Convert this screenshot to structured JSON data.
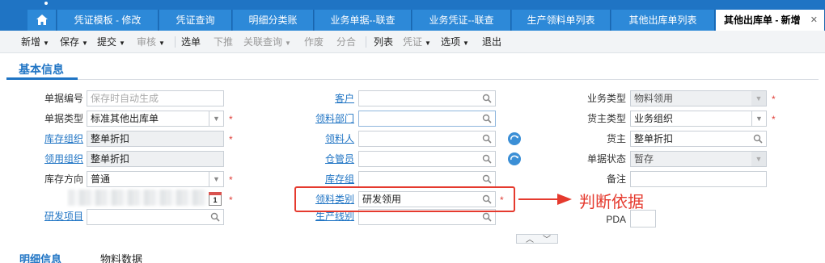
{
  "tabs": [
    {
      "label": "凭证模板 - 修改"
    },
    {
      "label": "凭证查询"
    },
    {
      "label": "明细分类账"
    },
    {
      "label": "业务单据--联查"
    },
    {
      "label": "业务凭证--联查"
    },
    {
      "label": "生产领料单列表"
    },
    {
      "label": "其他出库单列表"
    },
    {
      "label": "其他出库单 - 新增"
    }
  ],
  "toolbar": {
    "new": "新增",
    "save": "保存",
    "submit": "提交",
    "audit": "审核",
    "select": "选单",
    "push": "下推",
    "link_query": "关联查询",
    "void": "作废",
    "merge": "分合",
    "list": "列表",
    "voucher": "凭证",
    "options": "选项",
    "exit": "退出"
  },
  "section": {
    "title": "基本信息"
  },
  "form": {
    "doc_no": {
      "label": "单据编号",
      "placeholder": "保存时自动生成"
    },
    "doc_type": {
      "label": "单据类型",
      "value": "标准其他出库单"
    },
    "stock_org": {
      "label": "库存组织",
      "value": "整单折扣"
    },
    "use_org": {
      "label": "领用组织",
      "value": "整单折扣"
    },
    "stock_dir": {
      "label": "库存方向",
      "value": "普通"
    },
    "date": {
      "cal_day": "1"
    },
    "rd_project": {
      "label": "研发项目",
      "value": ""
    },
    "customer": {
      "label": "客户",
      "value": ""
    },
    "dept": {
      "label": "领料部门",
      "value": ""
    },
    "picker": {
      "label": "领料人",
      "value": ""
    },
    "keeper": {
      "label": "仓管员",
      "value": ""
    },
    "stock_group": {
      "label": "库存组",
      "value": ""
    },
    "pick_type": {
      "label": "领料类别",
      "value": "研发领用"
    },
    "prod_line": {
      "label": "生产线别",
      "value": ""
    },
    "biz_type": {
      "label": "业务类型",
      "value": "物料领用"
    },
    "owner_type": {
      "label": "货主类型",
      "value": "业务组织"
    },
    "owner": {
      "label": "货主",
      "value": "整单折扣"
    },
    "doc_status": {
      "label": "单据状态",
      "value": "暂存"
    },
    "remark": {
      "label": "备注",
      "value": ""
    },
    "pda": {
      "label": "PDA",
      "value": ""
    }
  },
  "required_mark": "*",
  "annotation": {
    "text": "判断依据",
    "color": "#e53a2e"
  },
  "bottom_tabs": {
    "detail": "明细信息",
    "material": "物料数据"
  },
  "colors": {
    "brand": "#1f74c4",
    "highlight": "#e53a2e"
  }
}
